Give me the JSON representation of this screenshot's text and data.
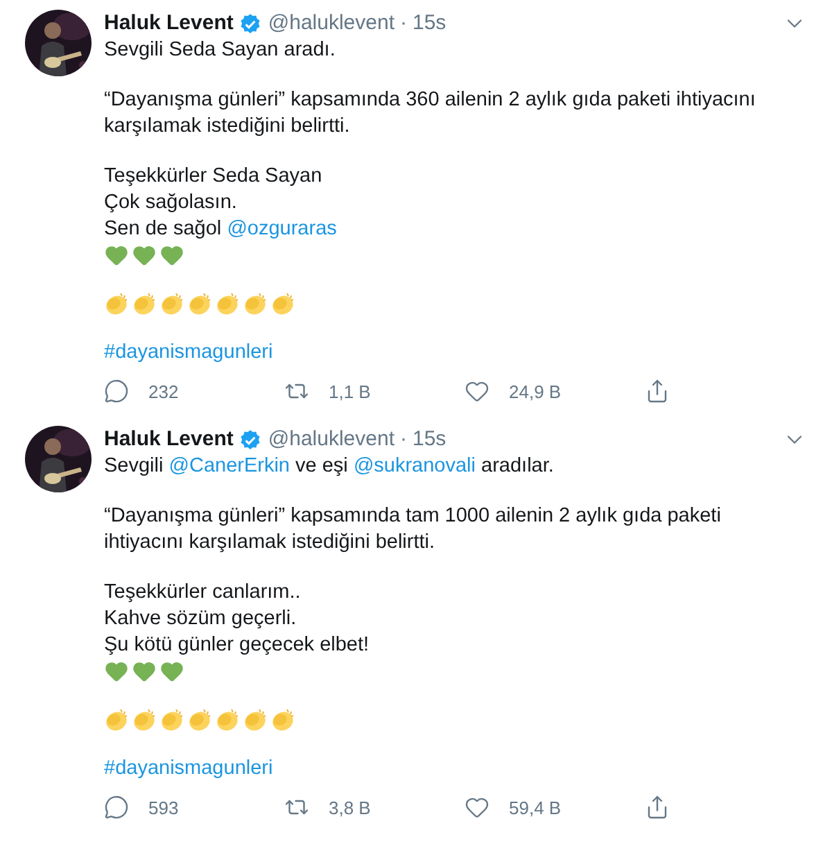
{
  "tweets": [
    {
      "author": {
        "name": "Haluk Levent",
        "verified": true,
        "handle": "@haluklevent",
        "separator": "·",
        "time": "15s"
      },
      "groups": [
        {
          "lines": [
            {
              "kind": "text",
              "parts": [
                {
                  "kind": "text",
                  "text": "Sevgili Seda Sayan aradı."
                }
              ]
            }
          ]
        },
        {
          "lines": [
            {
              "kind": "text",
              "parts": [
                {
                  "kind": "text",
                  "text": "“Dayanışma günleri” kapsamında 360 ailenin 2 aylık gıda paketi ihtiyacını karşılamak istediğini belirtti."
                }
              ]
            }
          ]
        },
        {
          "lines": [
            {
              "kind": "text",
              "parts": [
                {
                  "kind": "text",
                  "text": "Teşekkürler Seda Sayan"
                }
              ]
            },
            {
              "kind": "text",
              "parts": [
                {
                  "kind": "text",
                  "text": "Çok sağolasın."
                }
              ]
            },
            {
              "kind": "text",
              "parts": [
                {
                  "kind": "text",
                  "text": "Sen de sağol "
                },
                {
                  "kind": "link",
                  "text": "@ozguraras"
                }
              ]
            },
            {
              "kind": "emoji",
              "items": [
                {
                  "kind": "green_heart"
                },
                {
                  "kind": "green_heart"
                },
                {
                  "kind": "green_heart"
                }
              ]
            }
          ]
        },
        {
          "lines": [
            {
              "kind": "emoji",
              "items": [
                {
                  "kind": "clap"
                },
                {
                  "kind": "clap"
                },
                {
                  "kind": "clap"
                },
                {
                  "kind": "clap"
                },
                {
                  "kind": "clap"
                },
                {
                  "kind": "clap"
                },
                {
                  "kind": "clap"
                }
              ]
            }
          ]
        },
        {
          "lines": [
            {
              "kind": "text",
              "parts": [
                {
                  "kind": "link",
                  "text": "#dayanismagunleri"
                }
              ]
            }
          ]
        }
      ],
      "actions": [
        {
          "kind": "reply",
          "count": "232"
        },
        {
          "kind": "retweet",
          "count": "1,1 B"
        },
        {
          "kind": "like",
          "count": "24,9 B"
        },
        {
          "kind": "share"
        }
      ]
    },
    {
      "author": {
        "name": "Haluk Levent",
        "verified": true,
        "handle": "@haluklevent",
        "separator": "·",
        "time": "15s"
      },
      "groups": [
        {
          "lines": [
            {
              "kind": "text",
              "parts": [
                {
                  "kind": "text",
                  "text": "Sevgili "
                },
                {
                  "kind": "link",
                  "text": "@CanerErkin"
                },
                {
                  "kind": "text",
                  "text": " ve eşi "
                },
                {
                  "kind": "link",
                  "text": "@sukranovali"
                },
                {
                  "kind": "text",
                  "text": " aradılar."
                }
              ]
            }
          ]
        },
        {
          "lines": [
            {
              "kind": "text",
              "parts": [
                {
                  "kind": "text",
                  "text": "“Dayanışma günleri” kapsamında tam 1000 ailenin 2 aylık gıda paketi ihtiyacını karşılamak istediğini belirtti."
                }
              ]
            }
          ]
        },
        {
          "lines": [
            {
              "kind": "text",
              "parts": [
                {
                  "kind": "text",
                  "text": "Teşekkürler canlarım.."
                }
              ]
            },
            {
              "kind": "text",
              "parts": [
                {
                  "kind": "text",
                  "text": "Kahve sözüm geçerli."
                }
              ]
            },
            {
              "kind": "text",
              "parts": [
                {
                  "kind": "text",
                  "text": "Şu kötü günler geçecek elbet!"
                }
              ]
            },
            {
              "kind": "emoji",
              "items": [
                {
                  "kind": "green_heart"
                },
                {
                  "kind": "green_heart"
                },
                {
                  "kind": "green_heart"
                }
              ]
            }
          ]
        },
        {
          "lines": [
            {
              "kind": "emoji",
              "items": [
                {
                  "kind": "clap"
                },
                {
                  "kind": "clap"
                },
                {
                  "kind": "clap"
                },
                {
                  "kind": "clap"
                },
                {
                  "kind": "clap"
                },
                {
                  "kind": "clap"
                },
                {
                  "kind": "clap"
                }
              ]
            }
          ]
        },
        {
          "lines": [
            {
              "kind": "text",
              "parts": [
                {
                  "kind": "link",
                  "text": "#dayanismagunleri"
                }
              ]
            }
          ]
        }
      ],
      "actions": [
        {
          "kind": "reply",
          "count": "593"
        },
        {
          "kind": "retweet",
          "count": "3,8 B"
        },
        {
          "kind": "like",
          "count": "59,4 B"
        },
        {
          "kind": "share"
        }
      ]
    }
  ]
}
